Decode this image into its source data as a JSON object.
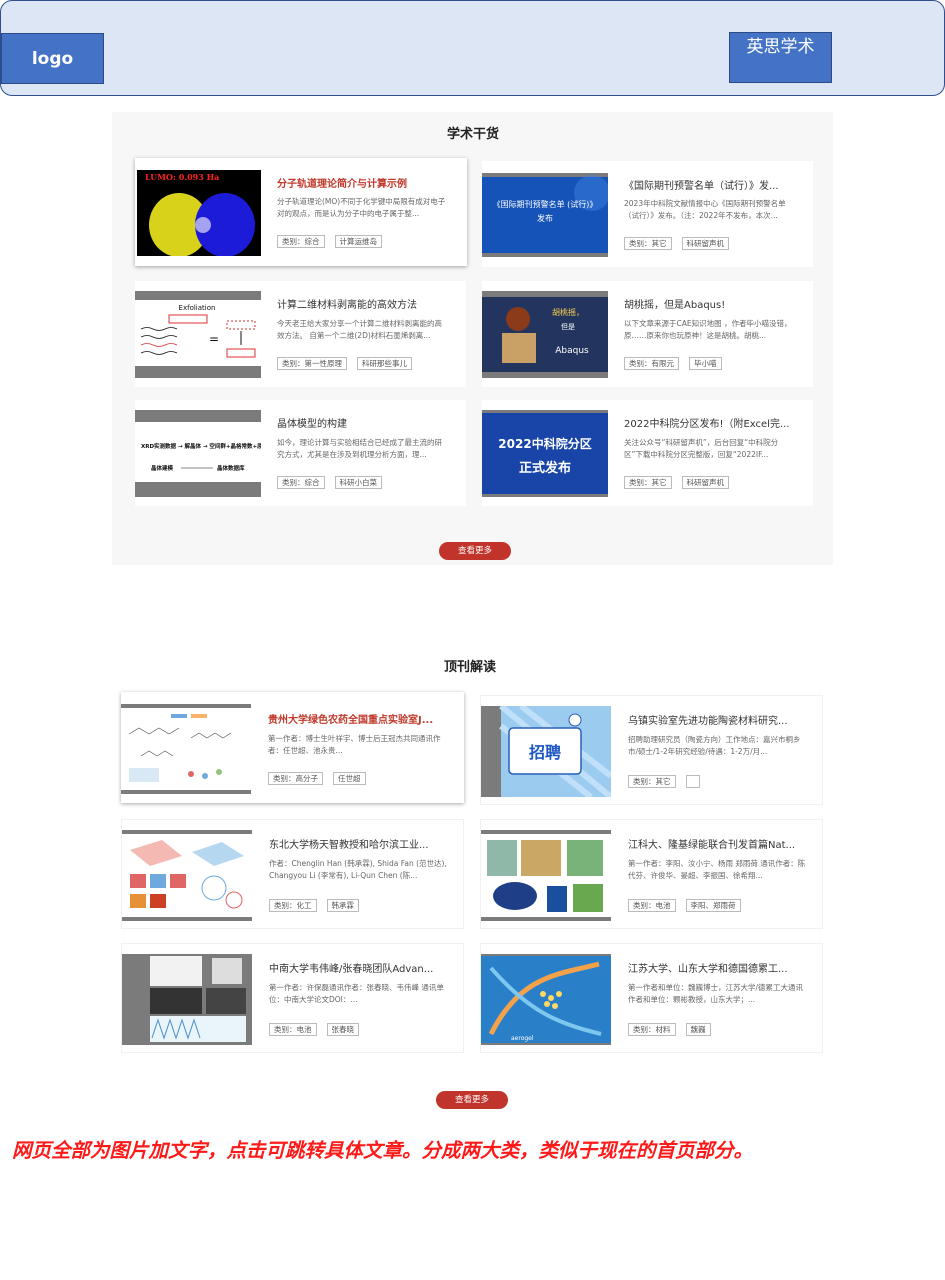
{
  "header": {
    "logo": "logo",
    "brand": "英思学术"
  },
  "section1": {
    "title": "学术干货",
    "more": "查看更多",
    "cards": [
      {
        "title": "分子轨道理论简介与计算示例",
        "desc": "分子轨道理论(MO)不同于化学键中局限有成对电子对的观点，而是认为分子中的电子属于整...",
        "tags": [
          "类别：综合",
          "计算运维岛"
        ],
        "thumb_text": "LUMO: 0.093 Ha"
      },
      {
        "title": "《国际期刊预警名单（试行）》发...",
        "desc": "2023年中科院文献情报中心《国际期刊预警名单（试行）》发布。（注：2022年不发布，本次...",
        "tags": [
          "类别：其它",
          "科研留声机"
        ],
        "thumb_text": "《国际期刊预警名单 (试行)》发布"
      },
      {
        "title": "计算二维材料剥离能的高效方法",
        "desc": "今天老王给大家分享一个计算二维材料剥离能的高效方法。 自第一个二维(2D)材料石墨烯剥离...",
        "tags": [
          "类别：第一性原理",
          "科研那些事儿"
        ],
        "thumb_text": "Exfoliation"
      },
      {
        "title": "胡桃摇，但是Abaqus!",
        "desc": "以下文章来源于CAE知识地图 ，作者毕小喵没错，原……原来你也玩原神！这是胡桃。胡桃...",
        "tags": [
          "类别：有限元",
          "毕小喵"
        ],
        "thumb_text": "胡桃摇，但是 Abaqus"
      },
      {
        "title": "晶体模型的构建",
        "desc": "如今，理论计算与实验相结合已经成了最主流的研究方式，尤其是在涉及到机理分析方面，理...",
        "tags": [
          "类别：综合",
          "科研小白菜"
        ],
        "thumb_text": "XRD实测数据 → 解晶体 → 空间群+晶格常数+原子坐标 / 晶体建模 ← 晶体数据库"
      },
      {
        "title": "2022中科院分区发布!（附Excel完...",
        "desc": "关注公众号“科研留声机”，后台回复“中科院分区”下载中科院分区完整版，回复“2022IF...",
        "tags": [
          "类别：其它",
          "科研留声机"
        ],
        "thumb_text": "2022中科院分区 正式发布"
      }
    ]
  },
  "section2": {
    "title": "顶刊解读",
    "more": "查看更多",
    "cards": [
      {
        "title": "贵州大学绿色农药全国重点实验室J...",
        "desc": "第一作者：博士生叶祥宇、博士后王冠杰共同通讯作者：任世超、池永贵...",
        "tags": [
          "类别：高分子",
          "任世超"
        ]
      },
      {
        "title": "乌镇实验室先进功能陶瓷材料研究...",
        "desc": "招聘助理研究员（陶瓷方向）工作地点：嘉兴市桐乡市/硕士/1-2年研究经验/待遇：1-2万/月...",
        "tags": [
          "类别：其它",
          ""
        ],
        "thumb_text": "招聘"
      },
      {
        "title": "东北大学杨天智教授和哈尔滨工业...",
        "desc": "作者：Chenglin Han (韩承霖), Shida Fan (范世达), Changyou Li (李常有), Li-Qun Chen (陈...",
        "tags": [
          "类别：化工",
          "韩承霖"
        ]
      },
      {
        "title": "江科大、隆基绿能联合刊发首篇Nat...",
        "desc": "第一作者：李阳、汝小宁、杨雨 郑雨荷 通讯作者：陈代芬、许俊华、晏超、李振国、徐希翔...",
        "tags": [
          "类别：电池",
          "李阳、郑雨荷"
        ]
      },
      {
        "title": "中南大学韦伟峰/张春晓团队Advan...",
        "desc": "第一作者：许保磊通讯作者：张春晓、韦伟峰 通讯单位：中南大学论文DOI：...",
        "tags": [
          "类别：电池",
          "张春晓"
        ]
      },
      {
        "title": "江苏大学、山东大学和德国德累工...",
        "desc": "第一作者和单位：魏巍博士，江苏大学/德累工大通讯作者和单位：颗彬教授，山东大学；...",
        "tags": [
          "类别：材料",
          "魏巍"
        ],
        "thumb_text": "aerogel"
      }
    ]
  },
  "note": "网页全部为图片加文字，点击可跳转具体文章。分成两大类，类似于现在的首页部分。"
}
